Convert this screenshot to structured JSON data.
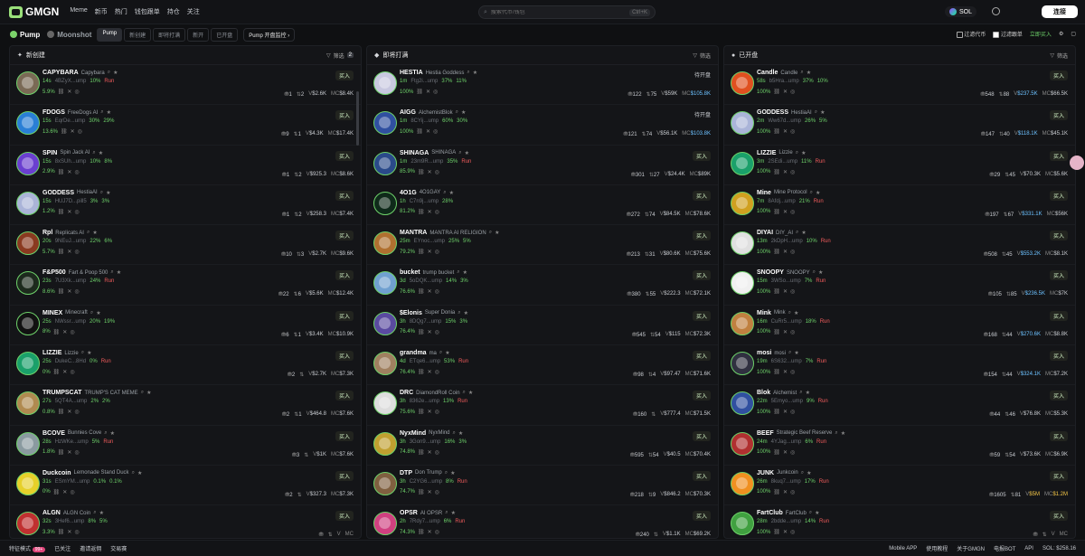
{
  "app": {
    "logo": "GMGN"
  },
  "nav": [
    "Meme",
    "新币",
    "热门",
    "钱包跟单",
    "持仓",
    "关注"
  ],
  "search": {
    "placeholder": "搜索代币/钱包",
    "shortcut": "Ctrl+K"
  },
  "chain": "SOL",
  "connect": "连接",
  "subbar": {
    "brand": "Pump",
    "moon": "Moonshot",
    "tabs": [
      "Pump",
      "新创建",
      "即将打满",
      "新开",
      "已开盘"
    ],
    "monitor": "Pump 开盘监控",
    "filter1": "过滤代币",
    "filter2": "过滤跟单",
    "quick": "立即买入"
  },
  "columns": [
    {
      "title": "新创建",
      "filter": "筛选",
      "filter_count": "2",
      "rows": [
        {
          "sym": "CAPYBARA",
          "name": "Capybara",
          "age": "14s",
          "addr": "4BZyX...ump",
          "p1": "10%",
          "p2": "Run",
          "p3": "5.9%",
          "holders": "1",
          "txs": "2",
          "vol": "$2.6K",
          "mc": "$8.4K",
          "avatar": "#7a6a55"
        },
        {
          "sym": "FDOGS",
          "name": "FreeDogs AI",
          "age": "15s",
          "addr": "EqrDe...ump",
          "p1": "30%",
          "p2": "29%",
          "p3": "13.6%",
          "holders": "9",
          "txs": "1",
          "vol": "$4.3K",
          "mc": "$17.4K",
          "avatar": "#2a7fd6"
        },
        {
          "sym": "SPIN",
          "name": "Spin Jack AI",
          "age": "15s",
          "addr": "8xSUh...ump",
          "p1": "10%",
          "p2": "8%",
          "p3": "2.9%",
          "holders": "1",
          "txs": "2",
          "vol": "$925.3",
          "mc": "$8.6K",
          "avatar": "#6a3fd0"
        },
        {
          "sym": "GODDESS",
          "name": "HestiaAI",
          "age": "15s",
          "addr": "HUJ7D...pill5",
          "p1": "3%",
          "p2": "3%",
          "p3": "1.2%",
          "holders": "1",
          "txs": "2",
          "vol": "$258.3",
          "mc": "$7.4K",
          "avatar": "#aab4d8"
        },
        {
          "sym": "Rpl",
          "name": "Replicats AI",
          "age": "20s",
          "addr": "9NEuJ...ump",
          "p1": "22%",
          "p2": "6%",
          "p3": "5.7%",
          "holders": "10",
          "txs": "3",
          "vol": "$2.7K",
          "mc": "$9.6K",
          "avatar": "#8a3a20"
        },
        {
          "sym": "F&P500",
          "name": "Fart & Poop 500",
          "age": "23s",
          "addr": "7U3Xk...ump",
          "p1": "24%",
          "p2": "Run",
          "p3": "8.6%",
          "holders": "22",
          "txs": "6",
          "vol": "$5.6K",
          "mc": "$12.4K",
          "avatar": "#1d2a1d"
        },
        {
          "sym": "MINEX",
          "name": "Minecraft",
          "age": "25s",
          "addr": "NWssr...ump",
          "p1": "20%",
          "p2": "19%",
          "p3": "8%",
          "holders": "6",
          "txs": "1",
          "vol": "$3.4K",
          "mc": "$10.9K",
          "avatar": "#111"
        },
        {
          "sym": "LIZZIE",
          "name": "Lizzie",
          "age": "25s",
          "addr": "DukeC...8Hd",
          "p1": "0%",
          "p2": "Run",
          "p3": "0%",
          "holders": "2",
          "txs": "",
          "vol": "$2.7K",
          "mc": "$7.3K",
          "avatar": "#1aa06a"
        },
        {
          "sym": "TRUMPSCAT",
          "name": "TRUMP'S CAT MEME",
          "age": "27s",
          "addr": "5QT4A...ump",
          "p1": "2%",
          "p2": "2%",
          "p3": "0.8%",
          "holders": "2",
          "txs": "1",
          "vol": "$464.8",
          "mc": "$7.6K",
          "avatar": "#b08a50"
        },
        {
          "sym": "BCOVE",
          "name": "Bunnies Cove",
          "age": "28s",
          "addr": "HzWKe...ump",
          "p1": "5%",
          "p2": "Run",
          "p3": "1.8%",
          "holders": "3",
          "txs": "",
          "vol": "$1K",
          "mc": "$7.6K",
          "avatar": "#8a9aa0"
        },
        {
          "sym": "Duckcoin",
          "name": "Lemonade Stand Duck",
          "age": "31s",
          "addr": "ESmYM...ump",
          "p1": "0.1%",
          "p2": "0.1%",
          "p3": "0%",
          "holders": "2",
          "txs": "",
          "vol": "$327.3",
          "mc": "$7.3K",
          "avatar": "#e6d02a"
        },
        {
          "sym": "ALGN",
          "name": "ALGN Coin",
          "age": "32s",
          "addr": "3Hef6...ump",
          "p1": "8%",
          "p2": "5%",
          "p3": "3.3%",
          "holders": "",
          "txs": "",
          "vol": "",
          "mc": "",
          "avatar": "#c03030"
        }
      ]
    },
    {
      "title": "即将打满",
      "filter": "筛选",
      "rows": [
        {
          "sym": "HESTIA",
          "name": "Hestia Goddess",
          "age": "1m",
          "addr": "Ftg2i...ump",
          "p1": "37%",
          "p2": "11%",
          "p3": "100%",
          "status": "待开盘",
          "holders": "122",
          "txs": "75",
          "vol": "$59K",
          "mc": "$105.8K",
          "avatar": "#c8c8e0",
          "mcClass": "mc-hi"
        },
        {
          "sym": "AIGG",
          "name": "AlchemistBlok",
          "age": "1m",
          "addr": "8CYij...ump",
          "p1": "60%",
          "p2": "30%",
          "p3": "100%",
          "status": "待开盘",
          "holders": "121",
          "txs": "74",
          "vol": "$56.1K",
          "mc": "$103.8K",
          "avatar": "#3050a0",
          "mcClass": "mc-hi"
        },
        {
          "sym": "SHINAGA",
          "name": "SHINAGA",
          "age": "1m",
          "addr": "23m9R...ump",
          "p1": "35%",
          "p2": "Run",
          "p3": "85.9%",
          "holders": "301",
          "txs": "27",
          "vol": "$24.4K",
          "mc": "$89K",
          "avatar": "#2a4a8a"
        },
        {
          "sym": "4O1G",
          "name": "4O1GAY",
          "age": "1h",
          "addr": "C7n9j...ump",
          "p1": "28%",
          "p2": "",
          "p3": "81.2%",
          "holders": "272",
          "txs": "74",
          "vol": "$84.5K",
          "mc": "$78.6K",
          "avatar": "#0f2a1a"
        },
        {
          "sym": "MANTRA",
          "name": "MANTRA AI RELIGION",
          "age": "25m",
          "addr": "EYnoc...ump",
          "p1": "25%",
          "p2": "5%",
          "p3": "79.2%",
          "holders": "213",
          "txs": "31",
          "vol": "$80.6K",
          "mc": "$75.6K",
          "avatar": "#b07030"
        },
        {
          "sym": "bucket",
          "name": "trump bucket",
          "age": "3d",
          "addr": "5oDQK...ump",
          "p1": "14%",
          "p2": "3%",
          "p3": "76.6%",
          "holders": "380",
          "txs": "55",
          "vol": "$222.3",
          "mc": "$72.1K",
          "avatar": "#70a0d0"
        },
        {
          "sym": "$Elonis",
          "name": "Super Donia",
          "age": "3h",
          "addr": "8DQg7...ump",
          "p1": "15%",
          "p2": "3%",
          "p3": "76.4%",
          "holders": "545",
          "txs": "54",
          "vol": "$115",
          "mc": "$72.3K",
          "avatar": "#5a4aa0"
        },
        {
          "sym": "grandma",
          "name": "ma",
          "age": "4d",
          "addr": "ETqe6...ump",
          "p1": "53%",
          "p2": "Run",
          "p3": "76.4%",
          "holders": "98",
          "txs": "4",
          "vol": "$97.47",
          "mc": "$71.6K",
          "avatar": "#a08060"
        },
        {
          "sym": "DRC",
          "name": "DiamondRoll Coin",
          "age": "3h",
          "addr": "8362e...ump",
          "p1": "13%",
          "p2": "Run",
          "p3": "75.6%",
          "holders": "160",
          "txs": "",
          "vol": "$777.4",
          "mc": "$71.5K",
          "avatar": "#dddddd"
        },
        {
          "sym": "NyxMind",
          "name": "NyxMind",
          "age": "3h",
          "addr": "3Gon9...ump",
          "p1": "16%",
          "p2": "3%",
          "p3": "74.8%",
          "holders": "595",
          "txs": "54",
          "vol": "$40.5",
          "mc": "$70.4K",
          "avatar": "#c0a030"
        },
        {
          "sym": "DTP",
          "name": "Don Trump",
          "age": "3h",
          "addr": "C2YG6...ump",
          "p1": "8%",
          "p2": "Run",
          "p3": "74.7%",
          "holders": "218",
          "txs": "9",
          "vol": "$846.2",
          "mc": "$70.3K",
          "avatar": "#806040"
        },
        {
          "sym": "OPSR",
          "name": "AI OPSR",
          "age": "2h",
          "addr": "7Rdy7...ump",
          "p1": "6%",
          "p2": "Run",
          "p3": "74.3%",
          "holders": "240",
          "txs": "",
          "vol": "$1.1K",
          "mc": "$69.2K",
          "avatar": "#d04080"
        }
      ]
    },
    {
      "title": "已开盘",
      "filter": "筛选",
      "rows": [
        {
          "sym": "Candle",
          "name": "Candle",
          "age": "58s",
          "addr": "b5Hra...ump",
          "p1": "37%",
          "p2": "10%",
          "p3": "100%",
          "holders": "548",
          "txs": "88",
          "vol": "$237.5K",
          "mc": "$66.5K",
          "avatar": "#e05020",
          "volClass": "mc-hi"
        },
        {
          "sym": "GODDESS",
          "name": "HestiaAI",
          "age": "2m",
          "addr": "Ww67d...ump",
          "p1": "26%",
          "p2": "5%",
          "p3": "100%",
          "holders": "147",
          "txs": "40",
          "vol": "$118.1K",
          "mc": "$45.1K",
          "avatar": "#aab4d8",
          "volClass": "mc-hi"
        },
        {
          "sym": "LIZZIE",
          "name": "Lizzie",
          "age": "3m",
          "addr": "2SEdi...ump",
          "p1": "11%",
          "p2": "Run",
          "p3": "100%",
          "holders": "29",
          "txs": "45",
          "vol": "$70.3K",
          "mc": "$5.6K",
          "avatar": "#1aa06a"
        },
        {
          "sym": "Mine",
          "name": "Mine Protocol",
          "age": "7m",
          "addr": "8Afdj...ump",
          "p1": "21%",
          "p2": "Run",
          "p3": "100%",
          "holders": "197",
          "txs": "67",
          "vol": "$331.1K",
          "mc": "$56K",
          "avatar": "#d0a020",
          "volClass": "mc-hi"
        },
        {
          "sym": "DIYAI",
          "name": "DIY_AI",
          "age": "13m",
          "addr": "2kDpH...ump",
          "p1": "10%",
          "p2": "Run",
          "p3": "100%",
          "holders": "508",
          "txs": "45",
          "vol": "$553.2K",
          "mc": "$8.1K",
          "avatar": "#e0e0e0",
          "volClass": "mc-hi"
        },
        {
          "sym": "SNOOPY",
          "name": "SNOOPY",
          "age": "15m",
          "addr": "3WSo...ump",
          "p1": "7%",
          "p2": "Run",
          "p3": "100%",
          "holders": "105",
          "txs": "85",
          "vol": "$236.5K",
          "mc": "$7K",
          "avatar": "#f0f0f0",
          "volClass": "mc-hi"
        },
        {
          "sym": "Mink",
          "name": "Mink",
          "age": "16m",
          "addr": "CuRr5...ump",
          "p1": "18%",
          "p2": "Run",
          "p3": "100%",
          "holders": "168",
          "txs": "44",
          "vol": "$270.6K",
          "mc": "$8.8K",
          "avatar": "#c08040",
          "volClass": "mc-hi"
        },
        {
          "sym": "mosi",
          "name": "mosi",
          "age": "19m",
          "addr": "6S632...ump",
          "p1": "7%",
          "p2": "Run",
          "p3": "100%",
          "holders": "154",
          "txs": "44",
          "vol": "$324.1K",
          "mc": "$7.2K",
          "avatar": "#303040",
          "volClass": "mc-hi"
        },
        {
          "sym": "Blok",
          "name": "Alchemist",
          "age": "22m",
          "addr": "5Emyo...ump",
          "p1": "9%",
          "p2": "Run",
          "p3": "100%",
          "holders": "44",
          "txs": "46",
          "vol": "$76.8K",
          "mc": "$5.3K",
          "avatar": "#3050a0"
        },
        {
          "sym": "BEEF",
          "name": "Strategic Beef Reserve",
          "age": "24m",
          "addr": "4YJag...ump",
          "p1": "6%",
          "p2": "Run",
          "p3": "100%",
          "holders": "59",
          "txs": "54",
          "vol": "$73.6K",
          "mc": "$6.9K",
          "avatar": "#b03030"
        },
        {
          "sym": "JUNK",
          "name": "Junkcoin",
          "age": "26m",
          "addr": "8kuq7...ump",
          "p1": "17%",
          "p2": "Run",
          "p3": "100%",
          "holders": "1605",
          "txs": "81",
          "vol": "$5M",
          "mc": "$1.2M",
          "avatar": "#f09020",
          "volClass": "mc-y",
          "mcClass": "mc-y"
        },
        {
          "sym": "FartClub",
          "name": "FartClub",
          "age": "28m",
          "addr": "2bdde...ump",
          "p1": "14%",
          "p2": "Run",
          "p3": "100%",
          "holders": "",
          "txs": "",
          "vol": "",
          "mc": "",
          "avatar": "#40a040"
        }
      ]
    }
  ],
  "buy_label": "买入",
  "footer": {
    "left": [
      "特征模式",
      "已关注",
      "邀请返佣",
      "交易赛"
    ],
    "left_badge": "99+",
    "right": [
      "Mobile APP",
      "使用教程",
      "关于GMGN",
      "电报BOT",
      "API"
    ],
    "sol_price": "SOL: $258.16"
  }
}
